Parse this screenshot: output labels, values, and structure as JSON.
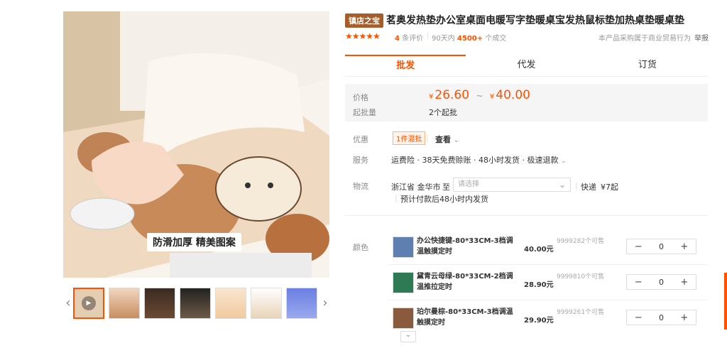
{
  "product": {
    "main_image_caption": "防滑加厚 精美图案",
    "badge": "镇店之宝",
    "title": "茗奥发热垫办公室桌面电暖写字垫暖桌宝发热鼠标垫加热桌垫暖桌垫",
    "rating_stars": "★★★★★",
    "review_count": "4",
    "review_label": "条评价",
    "period": "90天内",
    "sold_count": "4500+",
    "sold_label": "个成交",
    "business_note": "本产品采购属于商业贸易行为",
    "report": "举报"
  },
  "tabs": [
    {
      "label": "批发",
      "active": true
    },
    {
      "label": "代发",
      "active": false
    },
    {
      "label": "订货",
      "active": false
    }
  ],
  "price": {
    "label": "价格",
    "currency": "¥",
    "min": "26.60",
    "sep": "~",
    "max": "40.00",
    "moq_label": "起批量",
    "moq_value": "2个起批"
  },
  "promo": {
    "label": "优惠",
    "tag": "1件混批",
    "link": "查看"
  },
  "service": {
    "label": "服务",
    "text": "运费险 · 38天免费赊账 · 48小时发货 · 极速退款"
  },
  "logistics": {
    "label": "物流",
    "origin": "浙江省 金华市",
    "to": "至",
    "placeholder": "请选择",
    "method": "快递",
    "fee": "¥7起",
    "note": "预计付款后48小时内发货"
  },
  "color": {
    "label": "颜色",
    "skus": [
      {
        "name": "办公快捷键-80*33CM-3档调温触摸定时",
        "price": "40.00元",
        "stock": "9999282个可售",
        "qty": "0",
        "color": "#5e7fb0"
      },
      {
        "name": "黛青云母绿-80*33CM-2档调温推拉定时",
        "price": "28.90元",
        "stock": "9999810个可售",
        "qty": "0",
        "color": "#2e7a55"
      },
      {
        "name": "珀尔曼棕-80*33CM-3档调温触摸定时",
        "price": "29.90元",
        "stock": "9999261个可售",
        "qty": "0",
        "color": "#8a5a3c"
      }
    ]
  },
  "icons": {
    "minus": "−",
    "plus": "+",
    "chevron_down": "⌄",
    "left": "‹",
    "right": "›",
    "play": "▶"
  }
}
